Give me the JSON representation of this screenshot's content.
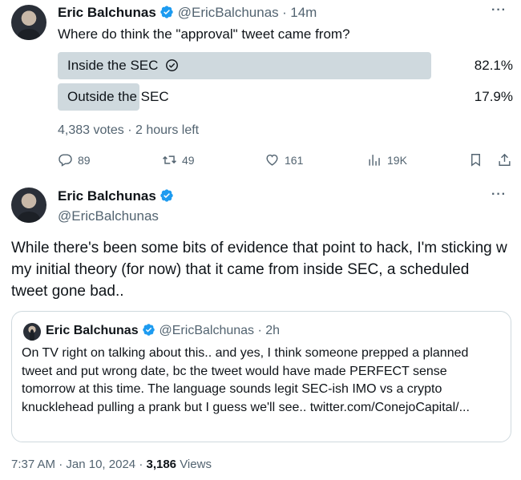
{
  "tweet1": {
    "name": "Eric Balchunas",
    "handle": "@EricBalchunas",
    "time_sep": "·",
    "time": "14m",
    "more": "···",
    "text": "Where do think the \"approval\" tweet came from?",
    "poll": {
      "options": [
        {
          "label": "Inside the SEC",
          "pct": "82.1%",
          "fraction": 0.821,
          "winner": true
        },
        {
          "label": "Outside the SEC",
          "pct": "17.9%",
          "fraction": 0.179,
          "winner": false
        }
      ],
      "votes": "4,383 votes",
      "sep": "·",
      "time_left": "2 hours left"
    },
    "actions": {
      "replies": "89",
      "retweets": "49",
      "likes": "161",
      "views": "19K"
    }
  },
  "tweet2": {
    "name": "Eric Balchunas",
    "handle": "@EricBalchunas",
    "more": "···",
    "body": "While there's been some bits of evidence that point to hack, I'm sticking w my initial theory (for now) that it came from inside SEC, a scheduled tweet gone bad..",
    "quote": {
      "name": "Eric Balchunas",
      "handle": "@EricBalchunas",
      "sep": "·",
      "time": "2h",
      "text": "On TV right on talking about this.. and yes, I think someone prepped a planned tweet and put wrong date, bc the tweet would have made PERFECT sense tomorrow at this time. The language sounds legit SEC-ish IMO vs a crypto knucklehead pulling a prank but I guess we'll see.. twitter.com/ConejoCapital/..."
    },
    "footer": {
      "time": "7:37 AM",
      "sep1": "·",
      "date": "Jan 10, 2024",
      "sep2": "·",
      "views": "3,186",
      "views_label": "Views"
    }
  },
  "colors": {
    "verified": "#1d9bf0",
    "text": "#0f1419",
    "secondary": "#536471",
    "poll_bar": "#cfd9de",
    "border": "#cfd9de"
  }
}
